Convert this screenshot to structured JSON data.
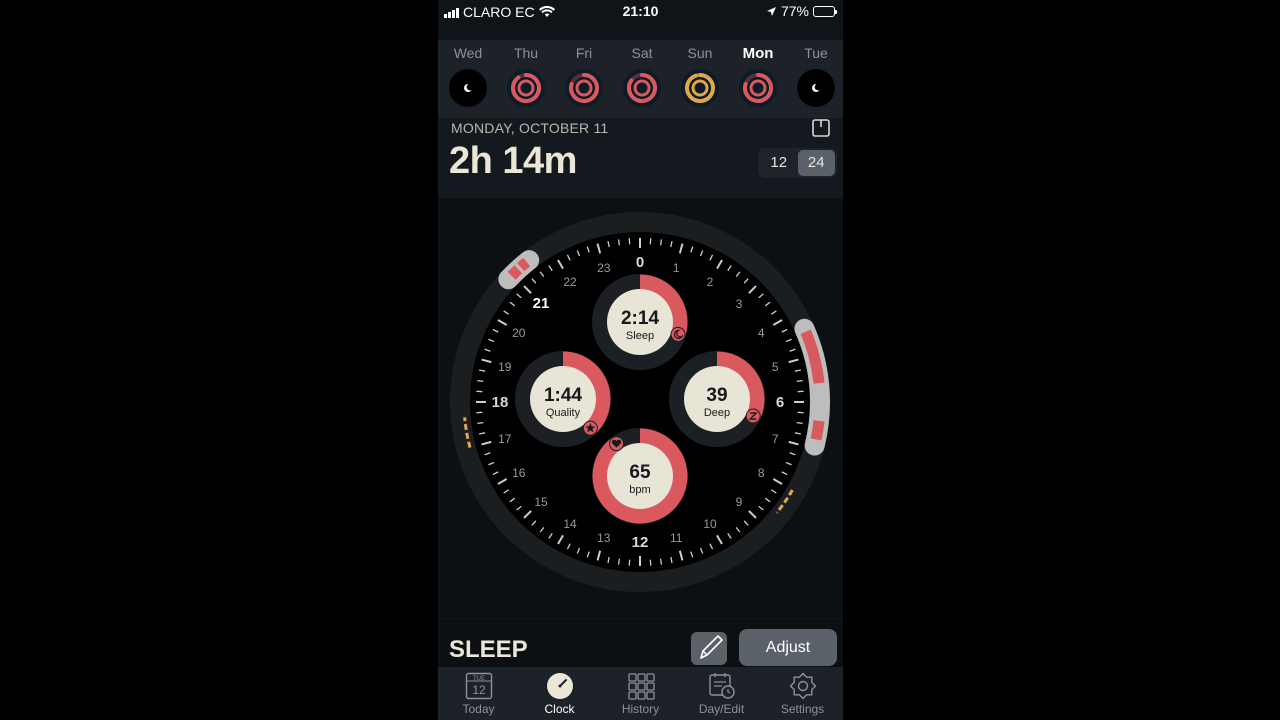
{
  "status_bar": {
    "carrier": "CLARO EC",
    "time": "21:10",
    "battery": "77%",
    "battery_level": 0.77
  },
  "week": {
    "days": [
      {
        "label": "Wed",
        "ring": "none",
        "ring_fraction": 0
      },
      {
        "label": "Thu",
        "ring": "#d9595e",
        "ring_fraction": 0.9
      },
      {
        "label": "Fri",
        "ring": "#d9595e",
        "ring_fraction": 0.8
      },
      {
        "label": "Sat",
        "ring": "#d9595e",
        "ring_fraction": 0.85
      },
      {
        "label": "Sun",
        "ring": "#e0a64a",
        "ring_fraction": 0.95
      },
      {
        "label": "Mon",
        "ring": "#d9595e",
        "ring_fraction": 0.8,
        "selected": true
      },
      {
        "label": "Tue",
        "ring": "none",
        "ring_fraction": 0
      }
    ]
  },
  "header": {
    "date": "MONDAY, OCTOBER 11",
    "duration": "2h 14m"
  },
  "format_toggle": {
    "options": [
      "12",
      "24"
    ],
    "active": "24"
  },
  "clock": {
    "hour_labels": [
      "0",
      "1",
      "2",
      "3",
      "4",
      "5",
      "6",
      "7",
      "8",
      "9",
      "10",
      "11",
      "12",
      "13",
      "14",
      "15",
      "16",
      "17",
      "18",
      "19",
      "20",
      "21",
      "22",
      "23"
    ],
    "current_hour": "21",
    "metrics": [
      {
        "key": "sleep",
        "value": "2:14",
        "label": "Sleep",
        "fraction": 0.3,
        "icon": "moon-icon"
      },
      {
        "key": "quality",
        "value": "1:44",
        "label": "Quality",
        "fraction": 0.38,
        "icon": "star-icon"
      },
      {
        "key": "deep",
        "value": "39",
        "label": "Deep",
        "fraction": 0.32,
        "icon": "z-icon"
      },
      {
        "key": "bpm",
        "value": "65",
        "label": "bpm",
        "fraction": 0.9,
        "icon": "heart-icon"
      }
    ],
    "accent": "#d9595e",
    "gold": "#e0a64a"
  },
  "footer": {
    "title": "SLEEP",
    "adjust_label": "Adjust"
  },
  "tabs": [
    {
      "label": "Today",
      "icon": "calendar-day-icon",
      "badge_top": "TUE",
      "badge_num": "12"
    },
    {
      "label": "Clock",
      "icon": "clock-icon",
      "active": true
    },
    {
      "label": "History",
      "icon": "grid-icon"
    },
    {
      "label": "Day/Edit",
      "icon": "calendar-edit-icon"
    },
    {
      "label": "Settings",
      "icon": "gear-icon"
    }
  ]
}
